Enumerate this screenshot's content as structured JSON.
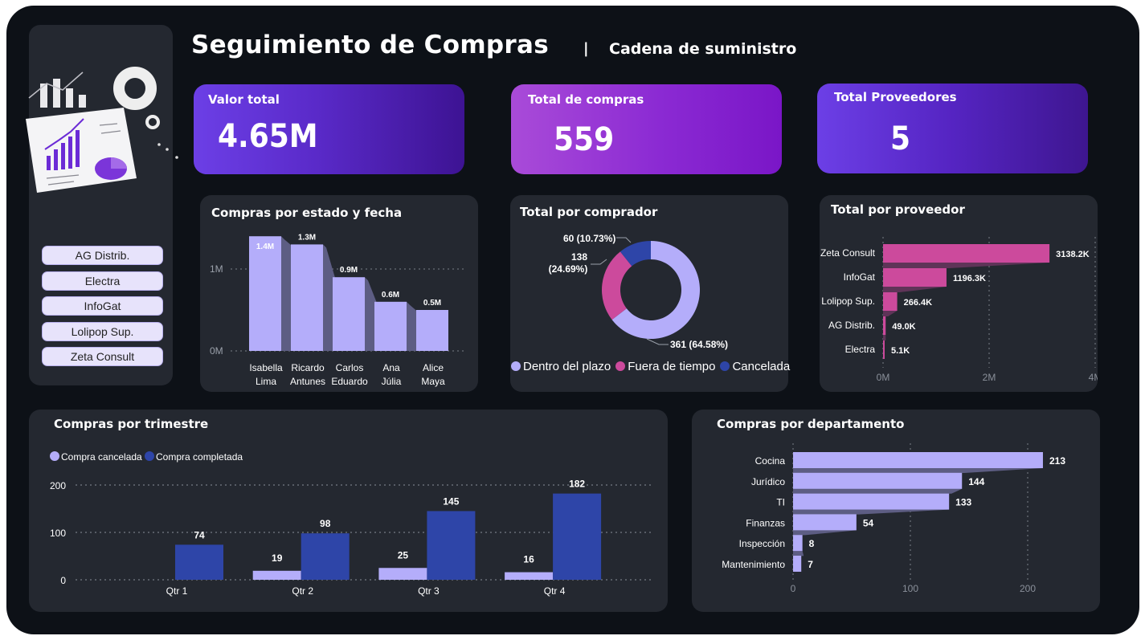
{
  "header": {
    "title": "Seguimiento de Compras",
    "separator": "|",
    "subtitle": "Cadena de suministro"
  },
  "colors": {
    "lavender": "#b4adfa",
    "magenta": "#cc4a9c",
    "blue": "#2e45a8",
    "panel": "#242830",
    "background": "#0d1117"
  },
  "kpis": [
    {
      "label": "Valor total",
      "value": "4.65M"
    },
    {
      "label": "Total de compras",
      "value": "559"
    },
    {
      "label": "Total Proveedores",
      "value": "5"
    }
  ],
  "slicer": {
    "items": [
      "AG Distrib.",
      "Electra",
      "InfoGat",
      "Lolipop Sup.",
      "Zeta Consult"
    ]
  },
  "chart_data": [
    {
      "id": "estado_fecha",
      "type": "bar",
      "title": "Compras por estado y fecha",
      "categories": [
        "Isabella Lima",
        "Ricardo Antunes",
        "Carlos Eduardo",
        "Ana Júlia",
        "Alice Maya"
      ],
      "category_lines": [
        [
          "Isabella",
          "Lima"
        ],
        [
          "Ricardo",
          "Antunes"
        ],
        [
          "Carlos",
          "Eduardo"
        ],
        [
          "Ana",
          "Júlia"
        ],
        [
          "Alice",
          "Maya"
        ]
      ],
      "values": [
        1.4,
        1.3,
        0.9,
        0.6,
        0.5
      ],
      "data_labels": [
        "1.4M",
        "1.3M",
        "0.9M",
        "0.6M",
        "0.5M"
      ],
      "yticks": [
        "0M",
        "1M"
      ],
      "ylim": [
        0,
        1.4
      ],
      "grid": true
    },
    {
      "id": "comprador",
      "type": "pie",
      "title": "Total por comprador",
      "series": [
        {
          "name": "Dentro del plazo",
          "value": 361,
          "label": "361 (64.58%)",
          "color": "#b4adfa"
        },
        {
          "name": "Fuera de tiempo",
          "value": 138,
          "label": "138 (24.69%)",
          "color": "#cc4a9c"
        },
        {
          "name": "Cancelada",
          "value": 60,
          "label": "60 (10.73%)",
          "color": "#2e45a8"
        }
      ],
      "legend": "bottom"
    },
    {
      "id": "proveedor",
      "type": "bar",
      "orientation": "horizontal",
      "title": "Total por proveedor",
      "categories": [
        "Zeta Consult",
        "InfoGat",
        "Lolipop Sup.",
        "AG Distrib.",
        "Electra"
      ],
      "values": [
        3138.2,
        1196.3,
        266.4,
        49.0,
        5.1
      ],
      "data_labels": [
        "3138.2K",
        "1196.3K",
        "266.4K",
        "49.0K",
        "5.1K"
      ],
      "xticks": [
        "0M",
        "2M",
        "4M"
      ],
      "xlim": [
        0,
        4000
      ],
      "grid": true
    },
    {
      "id": "trimestre",
      "type": "bar",
      "title": "Compras por trimestre",
      "categories": [
        "Qtr 1",
        "Qtr 2",
        "Qtr 3",
        "Qtr 4"
      ],
      "series": [
        {
          "name": "Compra cancelada",
          "values": [
            null,
            19,
            25,
            16
          ],
          "color": "#b4adfa"
        },
        {
          "name": "Compra completada",
          "values": [
            74,
            98,
            145,
            182
          ],
          "color": "#2e45a8"
        }
      ],
      "yticks": [
        "0",
        "100",
        "200"
      ],
      "ylim": [
        0,
        200
      ],
      "legend": "top-left",
      "grid": true
    },
    {
      "id": "departamento",
      "type": "bar",
      "orientation": "horizontal",
      "title": "Compras por departamento",
      "categories": [
        "Cocina",
        "Jurídico",
        "TI",
        "Finanzas",
        "Inspección",
        "Mantenimiento"
      ],
      "values": [
        213,
        144,
        133,
        54,
        8,
        7
      ],
      "xticks": [
        "0",
        "100",
        "200"
      ],
      "xlim": [
        0,
        200
      ],
      "grid": true
    }
  ]
}
